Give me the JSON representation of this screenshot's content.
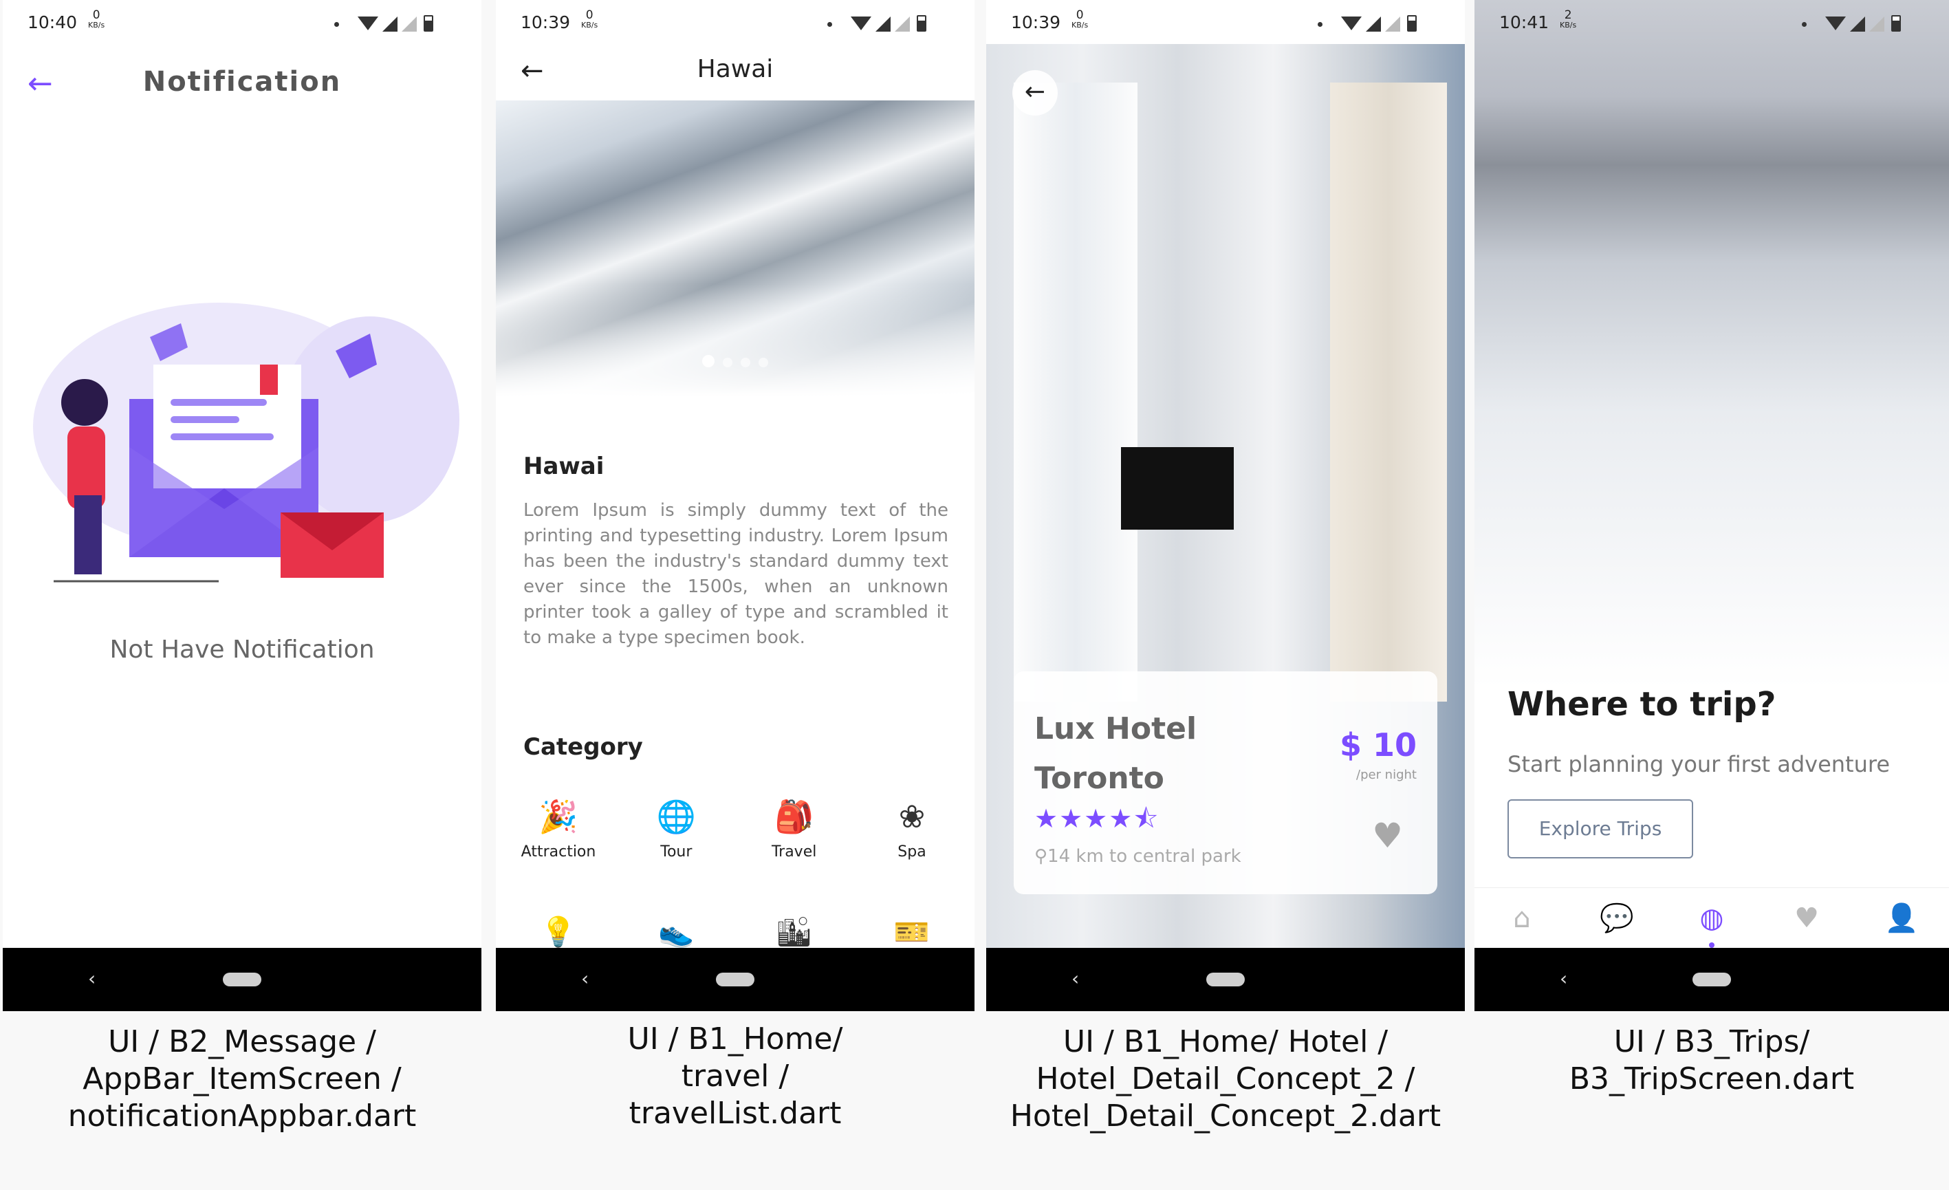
{
  "accent_color": "#7c4dff",
  "screens": [
    {
      "status": {
        "time": "10:40",
        "net_value": "0",
        "net_unit": "KB/s"
      },
      "appbar": {
        "back_icon": "arrow-left-icon",
        "title": "Notification"
      },
      "empty_text": "Not Have Notification",
      "caption": [
        "UI / B2_Message /",
        "AppBar_ItemScreen /",
        "notificationAppbar.dart"
      ]
    },
    {
      "status": {
        "time": "10:39",
        "net_value": "0",
        "net_unit": "KB/s"
      },
      "appbar": {
        "back_icon": "arrow-left-icon",
        "title": "Hawai"
      },
      "place_title": "Hawai",
      "description": "Lorem Ipsum is simply dummy text of the printing and typesetting industry. Lorem Ipsum has been the industry's standard dummy text ever since the 1500s, when an unknown printer took a galley of type and scrambled it to make a type specimen book.",
      "category_title": "Category",
      "categories": [
        {
          "label": "Attraction",
          "icon": "party-popper-icon"
        },
        {
          "label": "Tour",
          "icon": "globe-icon"
        },
        {
          "label": "Travel",
          "icon": "backpack-icon"
        },
        {
          "label": "Spa",
          "icon": "lotus-icon"
        }
      ],
      "caption": [
        "UI / B1_Home/",
        "travel /",
        "travelList.dart"
      ]
    },
    {
      "status": {
        "time": "10:39",
        "net_value": "0",
        "net_unit": "KB/s"
      },
      "hotel": {
        "name_line1": "Lux Hotel",
        "name_line2": "Toronto",
        "price": "$ 10",
        "per_night": "/per night",
        "rating": 4.5,
        "stars": "★★★★⯪",
        "distance": "14 km to central park"
      },
      "caption": [
        "UI / B1_Home/ Hotel /",
        "Hotel_Detail_Concept_2 /",
        "Hotel_Detail_Concept_2.dart"
      ]
    },
    {
      "status": {
        "time": "10:41",
        "net_value": "2",
        "net_unit": "KB/s"
      },
      "headline": "Where to trip?",
      "subtitle": "Start planning your first adventure",
      "button_label": "Explore Trips",
      "tabs": [
        "home-icon",
        "chat-icon",
        "explore-icon",
        "heart-pulse-icon",
        "person-icon"
      ],
      "active_tab": 2,
      "caption": [
        "UI / B3_Trips/",
        "B3_TripScreen.dart"
      ]
    }
  ]
}
